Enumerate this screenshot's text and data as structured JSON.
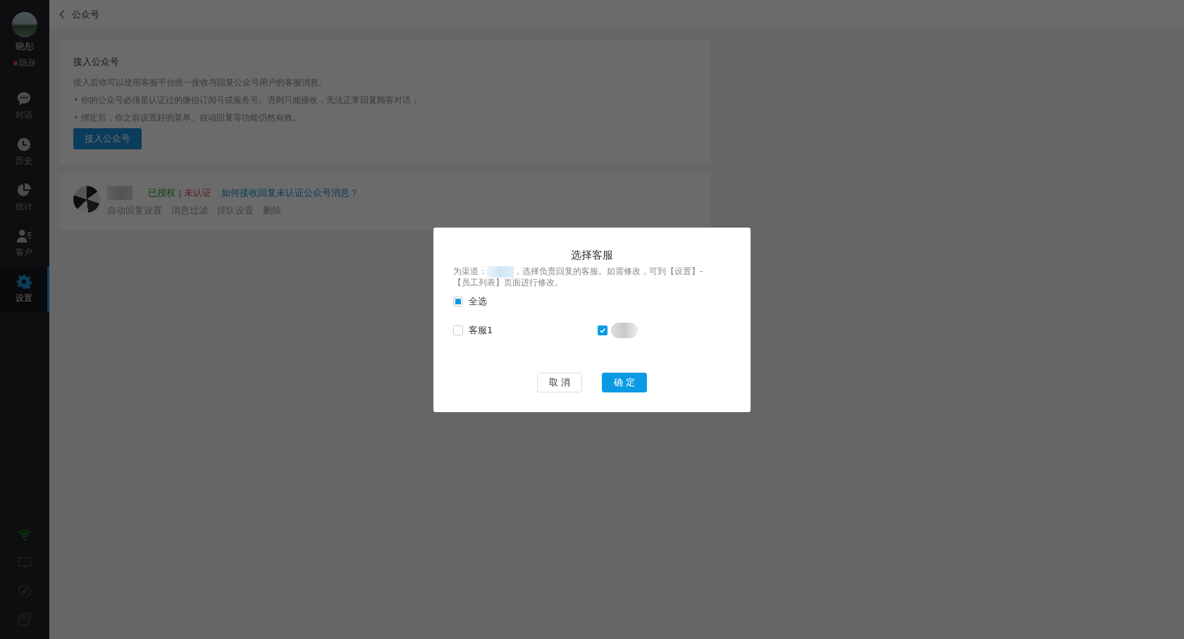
{
  "sidebar": {
    "user": {
      "name": "晓彤",
      "status": "隐身"
    },
    "nav": [
      {
        "label": "对话",
        "kind": "chat",
        "selected": false
      },
      {
        "label": "历史",
        "kind": "clock",
        "selected": false
      },
      {
        "label": "统计",
        "kind": "pie",
        "selected": false
      },
      {
        "label": "客户",
        "kind": "customer",
        "selected": false
      },
      {
        "label": "设置",
        "kind": "gear",
        "selected": true
      }
    ]
  },
  "header": {
    "title": "公众号"
  },
  "intro": {
    "title": "接入公众号",
    "description": "接入后你可以使用客服平台统一接收与回复公众号用户的客服消息。",
    "bullets": [
      "• 你的公众号必须是认证过的微信订阅号或服务号。否则只能接收，无法正常回复顾客对话；",
      "• 绑定后，你之前设置好的菜单、自动回复等功能仍然有效。"
    ],
    "button": "接入公众号"
  },
  "account": {
    "authorized": "已授权",
    "separator": "|",
    "unverified": "未认证",
    "help_link": "如何接收回复未认证公众号消息？",
    "actions": [
      "自动回复设置",
      "消息过滤",
      "排队设置",
      "删除"
    ]
  },
  "dialog": {
    "title": "选择客服",
    "description_prefix": "为渠道：",
    "description_suffix": "，选择负责回复的客服。如需修改，可到【设置】-",
    "description_line2": "【员工列表】页面进行修改。",
    "select_all": {
      "label": "全选",
      "checked": false,
      "indeterminate": true
    },
    "groups": [
      {
        "label": "客服1",
        "checked": false,
        "members": [
          {
            "checked": true
          }
        ]
      }
    ],
    "buttons": [
      {
        "label": "取 消",
        "kind": "secondary"
      },
      {
        "label": "确 定",
        "kind": "primary"
      }
    ]
  }
}
